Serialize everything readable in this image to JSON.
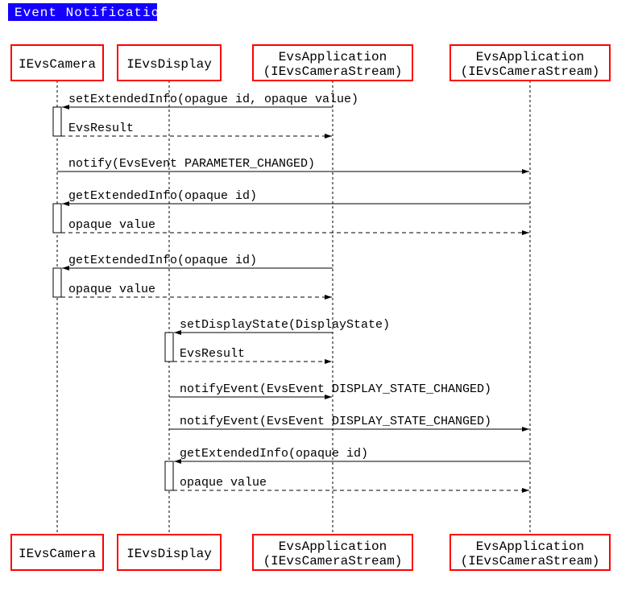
{
  "title": "Event Notification",
  "participants": {
    "camera": "IEvsCamera",
    "display": "IEvsDisplay",
    "app_line1": "EvsApplication",
    "app_line2": "(IEvsCameraStream)"
  },
  "messages": {
    "m1": "setExtendedInfo(opague id, opaque value)",
    "r1": "EvsResult",
    "m2": "notify(EvsEvent PARAMETER_CHANGED)",
    "m3": "getExtendedInfo(opaque id)",
    "r3": "opaque value",
    "m4": "getExtendedInfo(opaque id)",
    "r4": "opaque value",
    "m5": "setDisplayState(DisplayState)",
    "r5": "EvsResult",
    "m6": "notifyEvent(EvsEvent DISPLAY_STATE_CHANGED)",
    "m7": "getExtendedInfo(opaque id)",
    "r7": "opaque value"
  }
}
